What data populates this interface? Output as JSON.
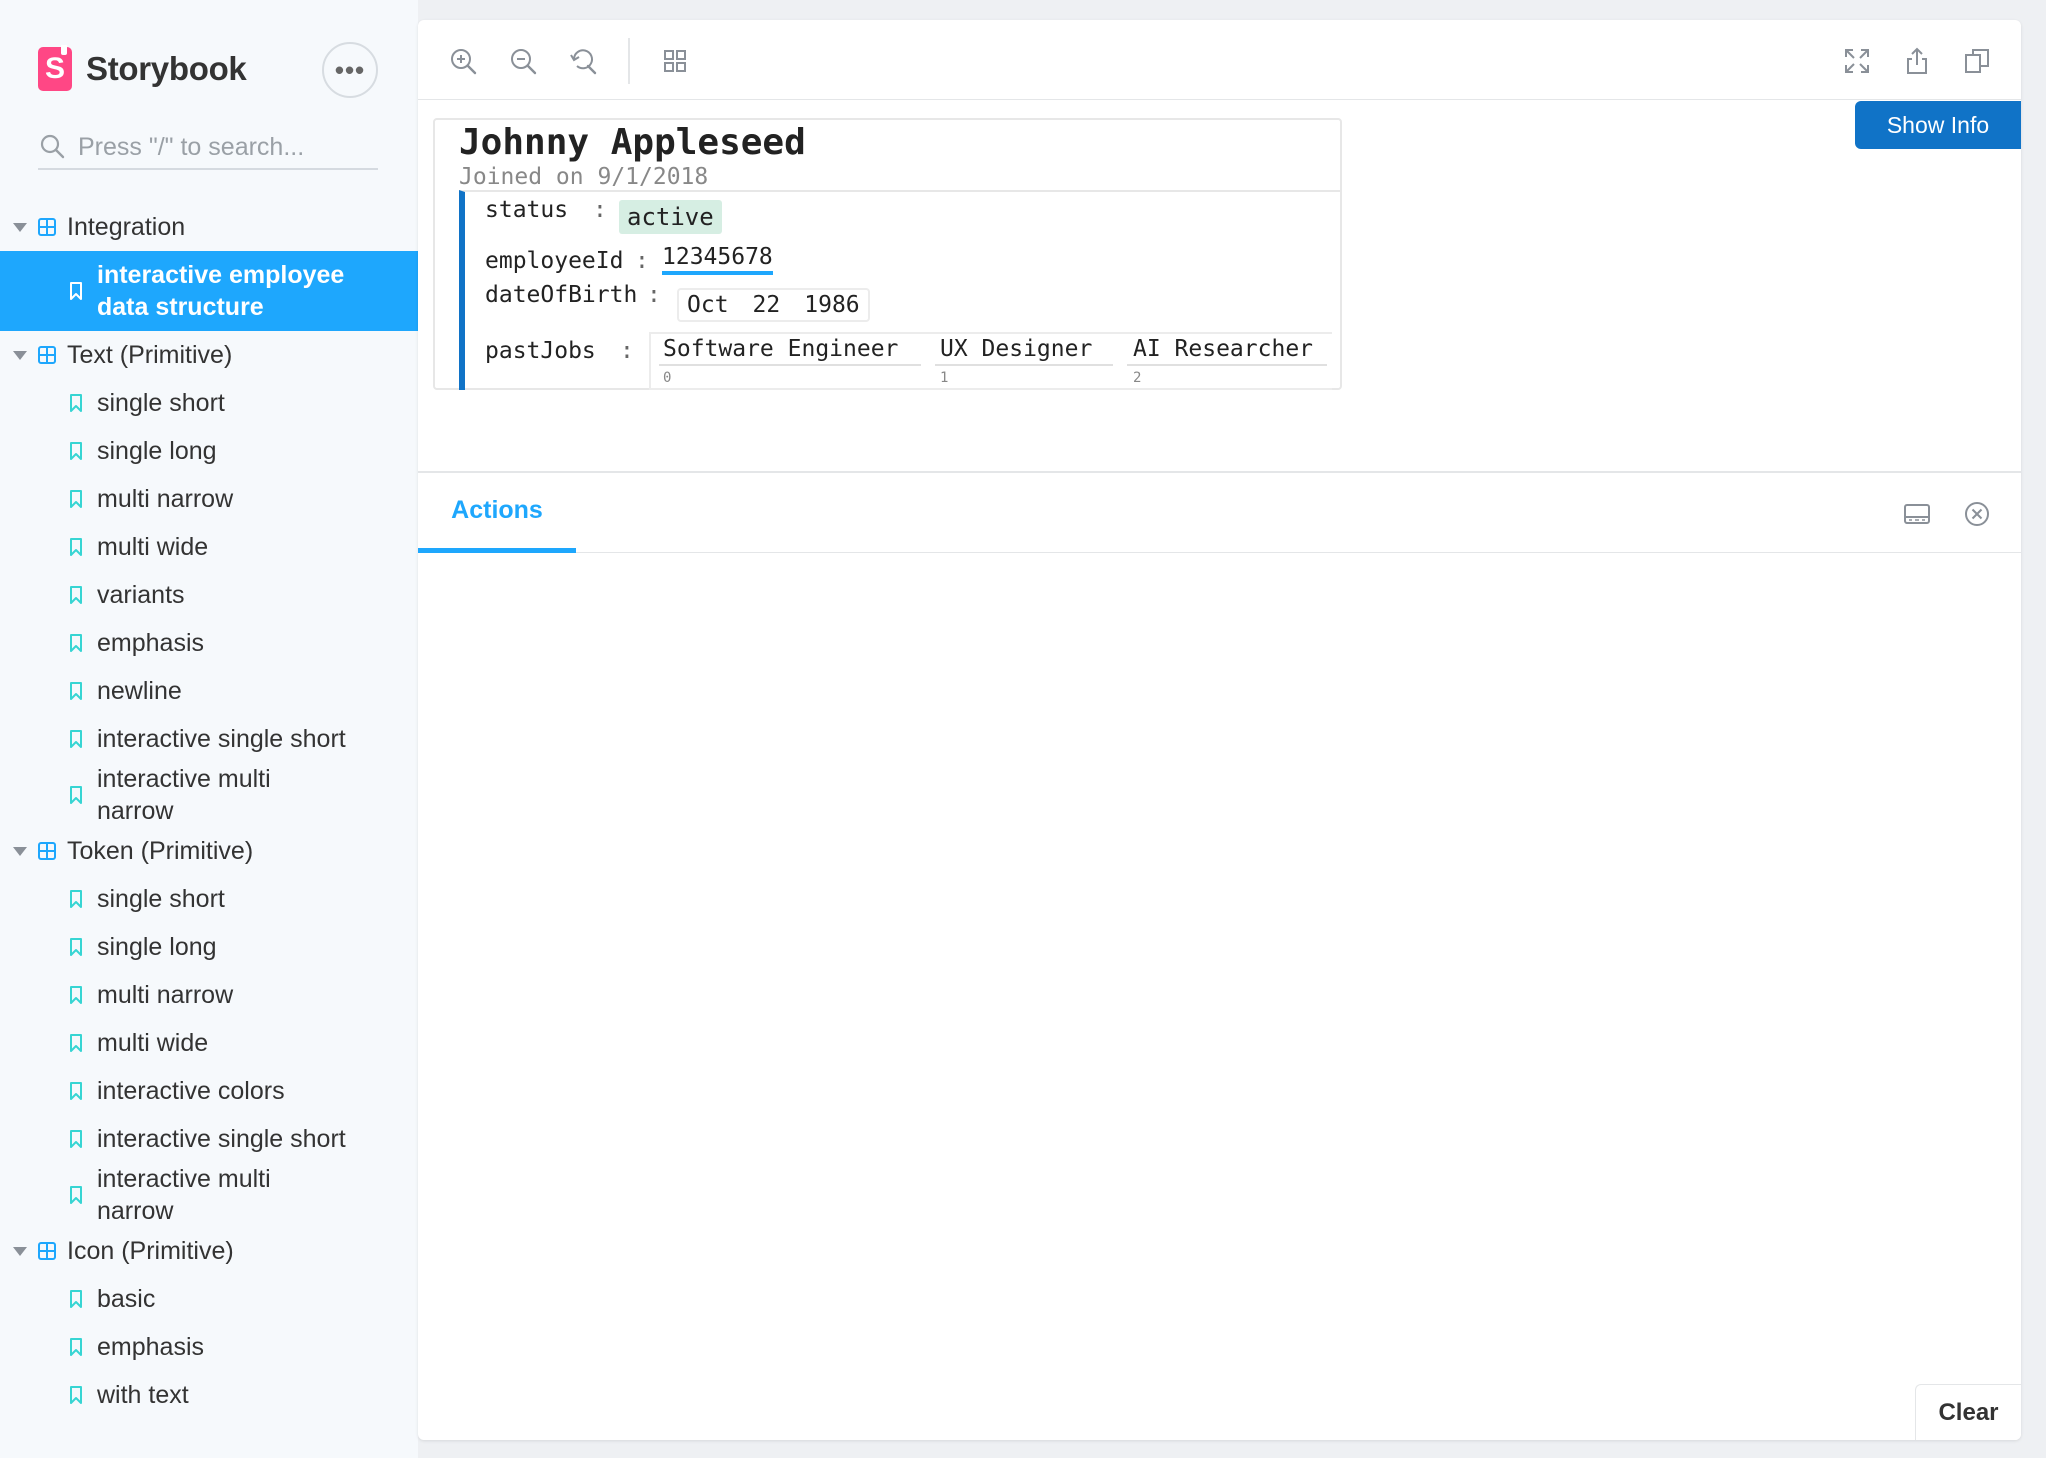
{
  "app": {
    "name": "Storybook",
    "logo_letter": "S",
    "more_glyph": "•••",
    "search_placeholder": "Press \"/\" to search..."
  },
  "sidebar": {
    "groups": [
      {
        "label": "Integration",
        "stories": [
          {
            "label": "interactive employee data structure",
            "active": true
          }
        ]
      },
      {
        "label": "Text (Primitive)",
        "stories": [
          {
            "label": "single short"
          },
          {
            "label": "single long"
          },
          {
            "label": "multi narrow"
          },
          {
            "label": "multi wide"
          },
          {
            "label": "variants"
          },
          {
            "label": "emphasis"
          },
          {
            "label": "newline"
          },
          {
            "label": "interactive single short"
          },
          {
            "label": "interactive multi narrow"
          }
        ]
      },
      {
        "label": "Token (Primitive)",
        "stories": [
          {
            "label": "single short"
          },
          {
            "label": "single long"
          },
          {
            "label": "multi narrow"
          },
          {
            "label": "multi wide"
          },
          {
            "label": "interactive colors"
          },
          {
            "label": "interactive single short"
          },
          {
            "label": "interactive multi narrow"
          }
        ]
      },
      {
        "label": "Icon (Primitive)",
        "stories": [
          {
            "label": "basic"
          },
          {
            "label": "emphasis"
          },
          {
            "label": "with text"
          }
        ]
      }
    ]
  },
  "toolbar": {
    "icons": [
      "zoom-in-icon",
      "zoom-out-icon",
      "reset-zoom-icon",
      "grid-icon",
      "fullscreen-icon",
      "share-icon",
      "copy-icon"
    ]
  },
  "preview": {
    "show_info_label": "Show Info",
    "employee": {
      "name": "Johnny Appleseed",
      "joined": "Joined on 9/1/2018",
      "fields": {
        "status_key": "status",
        "status_value": "active",
        "employee_id_key": "employeeId",
        "employee_id_value": "12345678",
        "dob_key": "dateOfBirth",
        "dob_month": "Oct",
        "dob_day": "22",
        "dob_year": "1986",
        "past_jobs_key": "pastJobs"
      },
      "past_jobs": [
        {
          "title": "Software Engineer",
          "index": "0"
        },
        {
          "title": "UX Designer",
          "index": "1"
        },
        {
          "title": "AI Researcher",
          "index": "2"
        }
      ]
    }
  },
  "addons": {
    "tab_label": "Actions",
    "clear_label": "Clear"
  },
  "colors": {
    "accent": "#1ea7fd",
    "brand": "#ff4785",
    "show_info_bg": "#1073c7",
    "status_bg": "#d6eee3"
  }
}
